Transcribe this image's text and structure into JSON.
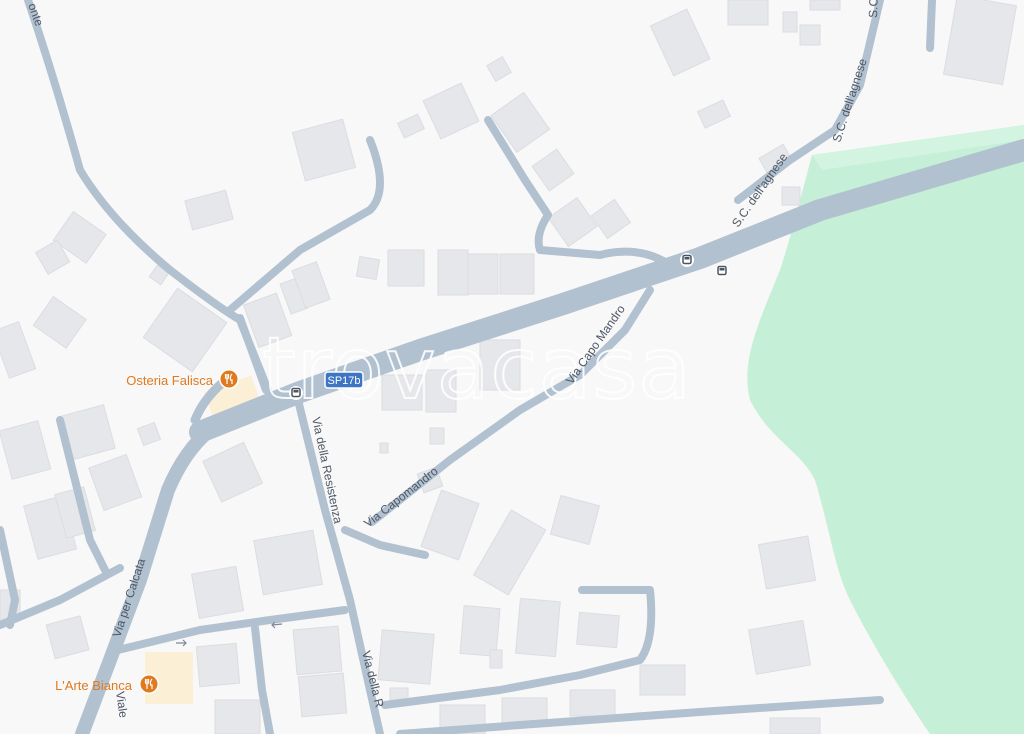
{
  "map": {
    "watermark": "trovacasa",
    "shield": {
      "label": "SP17b",
      "color": "#3d74c4"
    },
    "colors": {
      "background": "#f8f8f8",
      "road": "#b2c1d0",
      "park": "#c5efd6",
      "building": "#e6e7ea",
      "poi": "#e07a1f"
    },
    "street_labels": [
      "onte",
      "Via per Calcata",
      "Via della Resistenza",
      "Via Capomandro",
      "Via Capo Mandro",
      "S.C. dell'agnese",
      "S.C. dell'agnese",
      "S.C.",
      "Via della R",
      "Viale"
    ],
    "pois": [
      {
        "name": "Osteria Falisca",
        "icon": "restaurant-icon"
      },
      {
        "name": "L'Arte Bianca",
        "icon": "restaurant-icon"
      }
    ],
    "bus_stop_icons": [
      "bus-stop-icon",
      "bus-stop-icon",
      "bus-stop-icon"
    ]
  }
}
